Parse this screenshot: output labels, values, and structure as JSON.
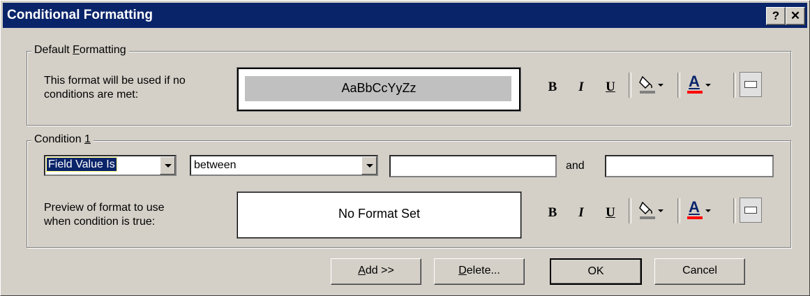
{
  "window": {
    "title": "Conditional Formatting",
    "help_glyph": "?",
    "close_glyph": "✕"
  },
  "default_formatting": {
    "legend_prefix": "Default ",
    "legend_underlined": "F",
    "legend_suffix": "ormatting",
    "description_line1": "This format will be used if no",
    "description_line2": "conditions are met:",
    "preview_text": "AaBbCcYyZz"
  },
  "condition1": {
    "legend_prefix": "Condition ",
    "legend_underlined": "1",
    "field_combo_value": "Field Value Is",
    "operator_combo_value": "between",
    "value1": "",
    "and_label": "and",
    "value2": "",
    "preview_label_line1": "Preview of format to use",
    "preview_label_line2": "when condition is true:",
    "preview_text": "No Format Set"
  },
  "format_toolbar": {
    "bold": "B",
    "italic": "I",
    "underline": "U",
    "font_color_letter": "A",
    "fill_color": "#808080",
    "font_color": "#ff0000"
  },
  "buttons": {
    "add_underlined": "A",
    "add_rest": "dd >>",
    "delete_underlined": "D",
    "delete_rest": "elete...",
    "ok": "OK",
    "cancel": "Cancel"
  }
}
